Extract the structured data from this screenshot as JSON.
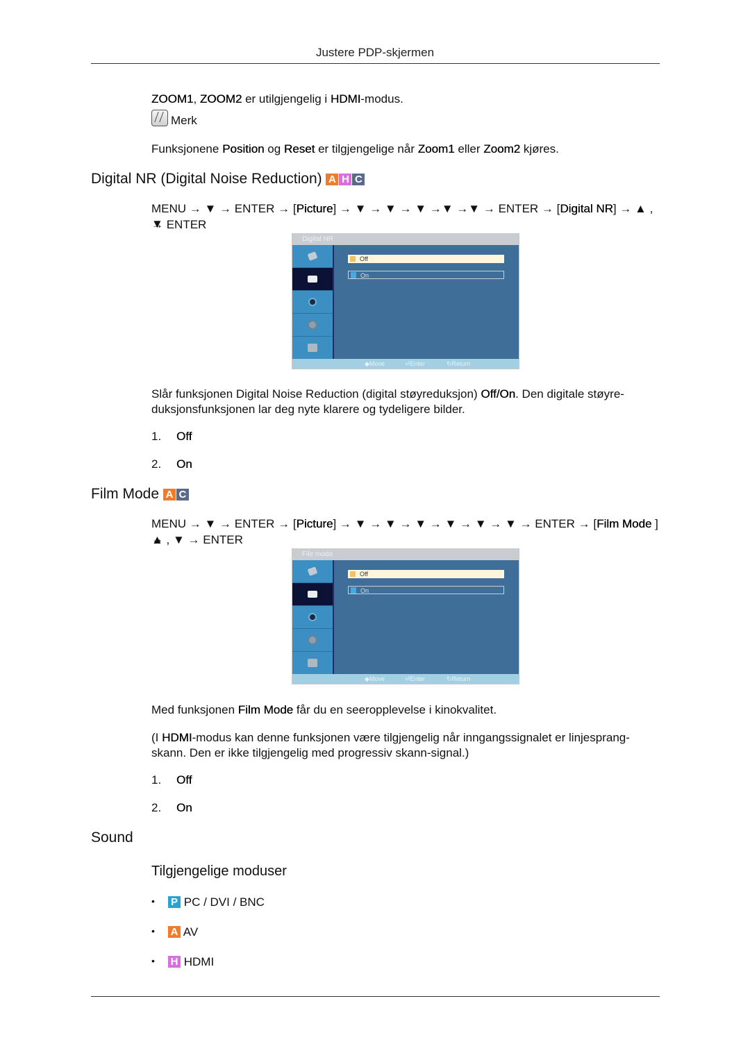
{
  "header": {
    "title": "Justere PDP-skjermen"
  },
  "intro": {
    "zoom_note": {
      "bold1": "ZOOM1",
      "sep": ", ",
      "bold2": "ZOOM2",
      "mid": " er utilgjengelig i ",
      "bold3": "HDMI",
      "end": "-modus."
    },
    "note_label": "Merk",
    "note_text": {
      "a": "Funksjonene ",
      "b": "Position",
      "c": " og ",
      "d": "Reset",
      "e": " er tilgjengelige når ",
      "f": "Zoom1",
      "g": " eller ",
      "h": "Zoom2",
      "i": " kjøres."
    }
  },
  "badges": {
    "A": {
      "letter": "A",
      "color": "#f07c2a"
    },
    "H": {
      "letter": "H",
      "color": "#d86ee0"
    },
    "C": {
      "letter": "C",
      "color": "#5a6a8c"
    },
    "P": {
      "letter": "P",
      "color": "#2aa3d0"
    }
  },
  "digital_nr": {
    "title": "Digital NR (Digital Noise Reduction)",
    "path_line1": {
      "pre": "MENU → ▼ → ENTER → [",
      "b1": "Picture",
      "mid": "] → ▼ → ▼ → ▼ →▼ →▼ → ENTER → [",
      "b2": "Digital NR",
      "post": "] → ▲ , ▼"
    },
    "path_line2": "→ ENTER",
    "osd": {
      "title": "Digital NR",
      "options": [
        "Off",
        "On"
      ],
      "selected": "Off",
      "footer": {
        "move": "Move",
        "enter": "Enter",
        "return": "Return"
      }
    },
    "desc": {
      "a": "Slår funksjonen Digital Noise Reduction (digital støyreduksjon) ",
      "b": "Off/On",
      "c": ". Den digitale støyre-",
      "line2": "duksjonsfunksjonen lar deg nyte klarere og tydeligere bilder."
    },
    "list": [
      {
        "num": "1.",
        "label": "Off"
      },
      {
        "num": "2.",
        "label": "On"
      }
    ]
  },
  "film_mode": {
    "title": "Film Mode",
    "path_line1": {
      "pre": "MENU → ▼ → ENTER → [",
      "b1": "Picture",
      "mid": "] → ▼ → ▼ → ▼ → ▼ → ▼ → ▼ → ENTER → [",
      "b2": "Film Mode",
      "post": " ] →"
    },
    "path_line2": "▲ , ▼ → ENTER",
    "osd": {
      "title": "File moda",
      "options": [
        "Off",
        "On"
      ],
      "selected": "Off",
      "footer": {
        "move": "Move",
        "enter": "Enter",
        "return": "Return"
      }
    },
    "desc1": {
      "a": "Med funksjonen ",
      "b": "Film Mode",
      "c": " får du en seeropplevelse i kinokvalitet."
    },
    "desc2": {
      "a": "(I ",
      "b": "HDMI",
      "c": "-modus kan denne funksjonen være tilgjengelig når inngangssignalet er linjesprang-",
      "line2": "skann. Den er ikke tilgjengelig med progressiv skann-signal.)"
    },
    "list": [
      {
        "num": "1.",
        "label": "Off"
      },
      {
        "num": "2.",
        "label": "On"
      }
    ]
  },
  "sound": {
    "title": "Sound",
    "subtitle": "Tilgjengelige moduser",
    "modes": [
      {
        "badge": "P",
        "label": "PC / DVI / BNC"
      },
      {
        "badge": "A",
        "label": "AV"
      },
      {
        "badge": "H",
        "label": "HDMI"
      }
    ],
    "bullet": "•"
  }
}
